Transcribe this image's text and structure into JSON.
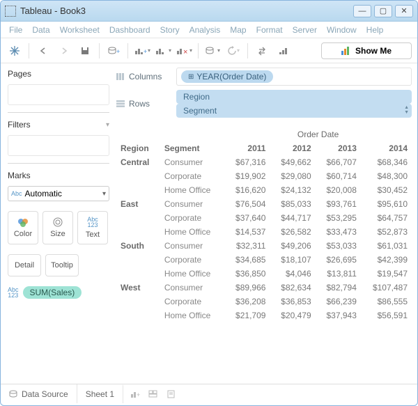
{
  "window": {
    "app": "Tableau",
    "title": "Tableau - Book3"
  },
  "menus": [
    "File",
    "Data",
    "Worksheet",
    "Dashboard",
    "Story",
    "Analysis",
    "Map",
    "Format",
    "Server",
    "Window",
    "Help"
  ],
  "toolbar": {
    "showme": "Show Me"
  },
  "panels": {
    "pages": "Pages",
    "filters": "Filters",
    "marks": "Marks",
    "marks_select": "Automatic",
    "mark_color": "Color",
    "mark_size": "Size",
    "mark_text": "Text",
    "mark_detail": "Detail",
    "mark_tooltip": "Tooltip",
    "sum_badge": "Abc\n123",
    "sum_pill": "SUM(Sales)"
  },
  "shelves": {
    "columns_label": "Columns",
    "rows_label": "Rows",
    "col_pill": "YEAR(Order Date)",
    "row_pills": [
      "Region",
      "Segment"
    ]
  },
  "crosstab": {
    "order_date_header": "Order Date",
    "region_header": "Region",
    "segment_header": "Segment",
    "years": [
      "2011",
      "2012",
      "2013",
      "2014"
    ],
    "rows": [
      {
        "region": "Central",
        "segment": "Consumer",
        "vals": [
          "$67,316",
          "$49,662",
          "$66,707",
          "$68,346"
        ]
      },
      {
        "region": "",
        "segment": "Corporate",
        "vals": [
          "$19,902",
          "$29,080",
          "$60,714",
          "$48,300"
        ]
      },
      {
        "region": "",
        "segment": "Home Office",
        "vals": [
          "$16,620",
          "$24,132",
          "$20,008",
          "$30,452"
        ]
      },
      {
        "region": "East",
        "segment": "Consumer",
        "vals": [
          "$76,504",
          "$85,033",
          "$93,761",
          "$95,610"
        ]
      },
      {
        "region": "",
        "segment": "Corporate",
        "vals": [
          "$37,640",
          "$44,717",
          "$53,295",
          "$64,757"
        ]
      },
      {
        "region": "",
        "segment": "Home Office",
        "vals": [
          "$14,537",
          "$26,582",
          "$33,473",
          "$52,873"
        ]
      },
      {
        "region": "South",
        "segment": "Consumer",
        "vals": [
          "$32,311",
          "$49,206",
          "$53,033",
          "$61,031"
        ]
      },
      {
        "region": "",
        "segment": "Corporate",
        "vals": [
          "$34,685",
          "$18,107",
          "$26,695",
          "$42,399"
        ]
      },
      {
        "region": "",
        "segment": "Home Office",
        "vals": [
          "$36,850",
          "$4,046",
          "$13,811",
          "$19,547"
        ]
      },
      {
        "region": "West",
        "segment": "Consumer",
        "vals": [
          "$89,966",
          "$82,634",
          "$82,794",
          "$107,487"
        ]
      },
      {
        "region": "",
        "segment": "Corporate",
        "vals": [
          "$36,208",
          "$36,853",
          "$66,239",
          "$86,555"
        ]
      },
      {
        "region": "",
        "segment": "Home Office",
        "vals": [
          "$21,709",
          "$20,479",
          "$37,943",
          "$56,591"
        ]
      }
    ]
  },
  "bottom": {
    "datasource": "Data Source",
    "sheet": "Sheet 1"
  },
  "chart_data": {
    "type": "table",
    "title": "SUM(Sales) by Region / Segment / Year(Order Date)",
    "columns_field": "YEAR(Order Date)",
    "rows_fields": [
      "Region",
      "Segment"
    ],
    "measure": "SUM(Sales)",
    "years": [
      2011,
      2012,
      2013,
      2014
    ],
    "regions": [
      "Central",
      "East",
      "South",
      "West"
    ],
    "segments": [
      "Consumer",
      "Corporate",
      "Home Office"
    ],
    "values": {
      "Central": {
        "Consumer": [
          67316,
          49662,
          66707,
          68346
        ],
        "Corporate": [
          19902,
          29080,
          60714,
          48300
        ],
        "Home Office": [
          16620,
          24132,
          20008,
          30452
        ]
      },
      "East": {
        "Consumer": [
          76504,
          85033,
          93761,
          95610
        ],
        "Corporate": [
          37640,
          44717,
          53295,
          64757
        ],
        "Home Office": [
          14537,
          26582,
          33473,
          52873
        ]
      },
      "South": {
        "Consumer": [
          32311,
          49206,
          53033,
          61031
        ],
        "Corporate": [
          34685,
          18107,
          26695,
          42399
        ],
        "Home Office": [
          36850,
          4046,
          13811,
          19547
        ]
      },
      "West": {
        "Consumer": [
          89966,
          82634,
          82794,
          107487
        ],
        "Corporate": [
          36208,
          36853,
          66239,
          86555
        ],
        "Home Office": [
          21709,
          20479,
          37943,
          56591
        ]
      }
    },
    "format": "USD, no decimals"
  }
}
